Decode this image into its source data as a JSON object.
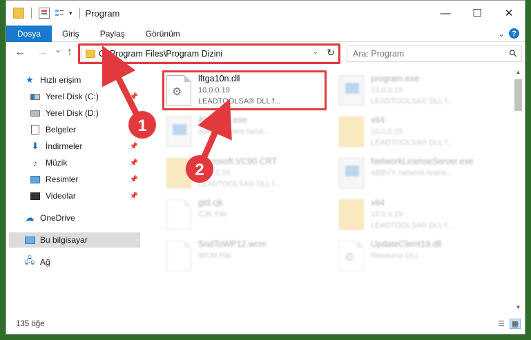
{
  "window": {
    "title": "Program",
    "controls": {
      "minimize": "—",
      "maximize": "☐",
      "close": "✕"
    }
  },
  "ribbon": {
    "tabs": [
      {
        "label": "Dosya",
        "active": true
      },
      {
        "label": "Giriş",
        "active": false
      },
      {
        "label": "Paylaş",
        "active": false
      },
      {
        "label": "Görünüm",
        "active": false
      }
    ],
    "help_label": "?"
  },
  "nav": {
    "back": "←",
    "forward": "→",
    "recent": "⌄",
    "up": "↑",
    "address": "C:\\Program Files\\Program Dizini",
    "refresh": "↻",
    "search_placeholder": "Ara: Program"
  },
  "sidebar": {
    "items": [
      {
        "label": "Hızlı erişim",
        "icon": "star-icon",
        "pinned": false
      },
      {
        "label": "Yerel Disk (C:)",
        "icon": "drive-icon",
        "pinned": true
      },
      {
        "label": "Yerel Disk (D:)",
        "icon": "drive-icon",
        "pinned": false
      },
      {
        "label": "Belgeler",
        "icon": "document-icon",
        "pinned": true
      },
      {
        "label": "İndirmeler",
        "icon": "download-icon",
        "pinned": true
      },
      {
        "label": "Müzik",
        "icon": "music-icon",
        "pinned": true
      },
      {
        "label": "Resimler",
        "icon": "picture-icon",
        "pinned": true
      },
      {
        "label": "Videolar",
        "icon": "video-icon",
        "pinned": true
      },
      {
        "label": "OneDrive",
        "icon": "cloud-icon",
        "pinned": false
      },
      {
        "label": "Bu bilgisayar",
        "icon": "computer-icon",
        "pinned": false,
        "selected": true
      },
      {
        "label": "Ağ",
        "icon": "network-icon",
        "pinned": false
      }
    ]
  },
  "files": [
    {
      "name": "lftga10n.dll",
      "line1": "10.0.0.19",
      "line2": "LEADTOOLSA® DLL f...",
      "icon": "dll-file-icon",
      "highlighted": true
    },
    {
      "name": "program.exe",
      "line1": "10.0.0.19",
      "line2": "LEADTOOLSA® DLL f...",
      "icon": "exe-file-icon",
      "highlighted": false
    },
    {
      "name": "AbbyyUI.exe",
      "line1": "ABBYY event hand...",
      "line2": "",
      "icon": "exe-file-icon",
      "highlighted": false
    },
    {
      "name": "x64",
      "line1": "10.0.0.19",
      "line2": "LEADTOOLSA® DLL f...",
      "icon": "folder-icon",
      "highlighted": false
    },
    {
      "name": "Microsoft.VC90.CRT",
      "line1": "10.0.0.19",
      "line2": "LEADTOOLSA® DLL f...",
      "icon": "folder-icon",
      "highlighted": false
    },
    {
      "name": "NetworkLicenseServer.exe",
      "line1": "ABBYY network licens...",
      "line2": "",
      "icon": "exe-file-icon",
      "highlighted": false
    },
    {
      "name": "gtd.cjk",
      "line1": "CJK File",
      "line2": "",
      "icon": "file-icon",
      "highlighted": false
    },
    {
      "name": "x64",
      "line1": "10.0.0.19",
      "line2": "LEADTOOLSA® DLL f...",
      "icon": "folder-icon",
      "highlighted": false
    },
    {
      "name": "SndToWP12.wcm",
      "line1": "WCM File",
      "line2": "",
      "icon": "file-icon",
      "highlighted": false
    },
    {
      "name": "UpdateClient19.dll",
      "line1": "Resource DLL",
      "line2": "",
      "icon": "dll-file-icon",
      "highlighted": false
    }
  ],
  "status": {
    "item_count": "135 öğe"
  },
  "annotations": {
    "step1": "1",
    "step2": "2"
  },
  "colors": {
    "accent": "#1979ca",
    "highlight": "#e2393f"
  }
}
